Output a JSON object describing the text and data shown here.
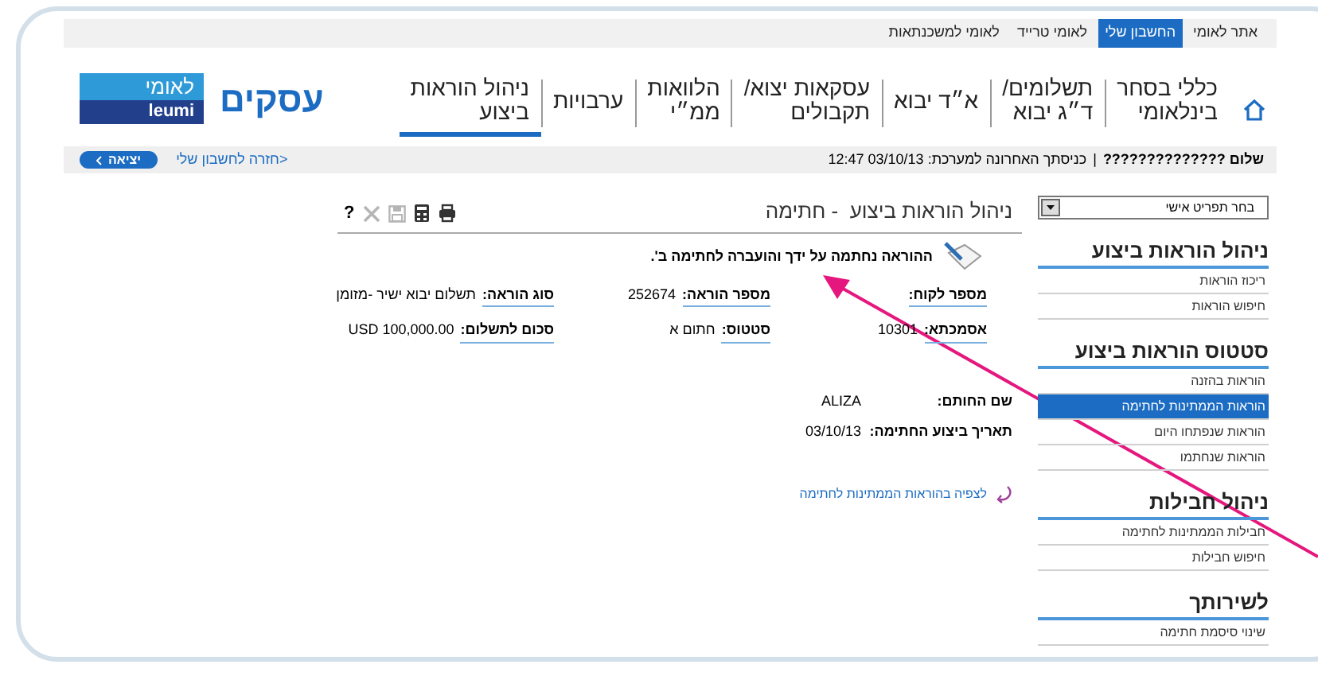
{
  "top_links": [
    {
      "label": "אתר לאומי",
      "selected": false
    },
    {
      "label": "החשבון שלי",
      "selected": true
    },
    {
      "label": "לאומי טרייד",
      "selected": false
    },
    {
      "label": "לאומי למשכנתאות",
      "selected": false
    }
  ],
  "nav": [
    {
      "label": "כללי בסחר\nבינלאומי",
      "selected": false
    },
    {
      "label": "תשלומים/\nד״ג יבוא",
      "selected": false
    },
    {
      "label": "א״ד יבוא",
      "selected": false
    },
    {
      "label": "עסקאות יצוא/\nתקבולים",
      "selected": false
    },
    {
      "label": "הלוואות\nממ״י",
      "selected": false
    },
    {
      "label": "ערבויות",
      "selected": false
    },
    {
      "label": "ניהול הוראות\nביצוע",
      "selected": true
    }
  ],
  "logo": {
    "brand": "עסקים",
    "hebrew": "לאומי",
    "latin": "leumi"
  },
  "info_bar": {
    "greeting": "שלום ??????????????",
    "separator": "|",
    "last_login": "כניסתך האחרונה למערכת: 03/10/13 12:47",
    "back_link": "<חזרה לחשבון שלי",
    "exit_button": "יציאה"
  },
  "sidebar": {
    "select_placeholder": "בחר תפריט אישי",
    "sections": [
      {
        "title": "ניהול הוראות ביצוע",
        "items": [
          {
            "label": "ריכוז הוראות",
            "selected": false
          },
          {
            "label": "חיפוש הוראות",
            "selected": false
          }
        ]
      },
      {
        "title": "סטטוס הוראות ביצוע",
        "items": [
          {
            "label": "הוראות בהזנה",
            "selected": false
          },
          {
            "label": "הוראות הממתינות לחתימה",
            "selected": true
          },
          {
            "label": "הוראות שנפתחו היום",
            "selected": false
          },
          {
            "label": "הוראות שנחתמו",
            "selected": false
          }
        ]
      },
      {
        "title": "ניהול חבילות",
        "items": [
          {
            "label": "חבילות הממתינות לחתימה",
            "selected": false
          },
          {
            "label": "חיפוש חבילות",
            "selected": false
          }
        ]
      },
      {
        "title": "לשירותך",
        "items": [
          {
            "label": "שינוי סיסמת חתימה",
            "selected": false
          }
        ]
      }
    ]
  },
  "main": {
    "title": "ניהול הוראות ביצוע  - חתימה",
    "toolbar": [
      {
        "kind": "print",
        "disabled": false
      },
      {
        "kind": "calculator",
        "disabled": false
      },
      {
        "kind": "save",
        "disabled": true
      },
      {
        "kind": "excel",
        "disabled": true
      }
    ],
    "help": "?",
    "message": "ההוראה נחתמה על ידך והועברה לחתימה ב'.",
    "fields": [
      {
        "label": "מספר לקוח:"
      },
      {
        "label": "מספר הוראה:",
        "value": "252674"
      },
      {
        "label": "סוג הוראה:",
        "value": "תשלום יבוא ישיר -מזומן"
      },
      {
        "label": "אסמכתא:",
        "value": "10301"
      },
      {
        "label": "סטטוס:",
        "value": "חתום א"
      },
      {
        "label": "סכום לתשלום:",
        "value": "USD 100,000.00"
      }
    ],
    "signer": [
      {
        "label": "שם החותם:",
        "value": "ALIZA"
      },
      {
        "label": "תאריך ביצוע החתימה:",
        "value": "03/10/13"
      }
    ],
    "link": "לצפיה בהוראות הממתינות לחתימה"
  }
}
